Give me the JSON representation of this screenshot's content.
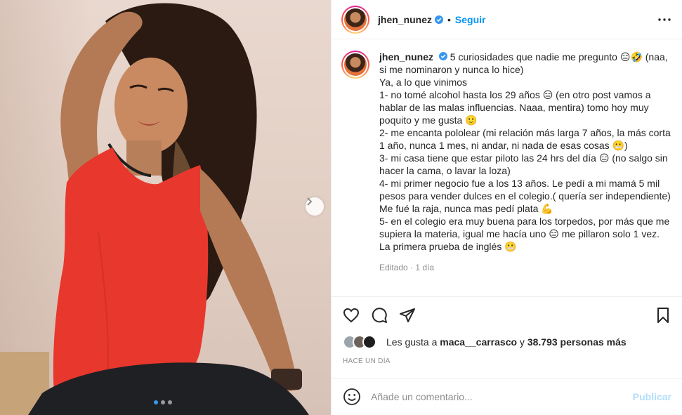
{
  "header": {
    "username": "jhen_nunez",
    "separator": "•",
    "follow_label": "Seguir",
    "more_icon": "more-horizontal-icon",
    "verified_icon": "verified-badge-icon"
  },
  "caption": {
    "username": "jhen_nunez",
    "lines": [
      "5 curiosidades que nadie me pregunto 😑🤣 (naa, si me nominaron y nunca lo hice)",
      "Ya, a lo que vinimos",
      "1- no tomé alcohol hasta los 29 años 😑 (en otro post vamos a hablar de las malas influencias. Naaa, mentira) tomo hoy muy poquito y me gusta 🙂",
      "2- me encanta pololear (mi relación más larga 7 años, la más corta 1 año, nunca 1 mes, ni andar, ni nada de esas cosas 😬)",
      "3- mi casa tiene que estar piloto las 24 hrs del día 😑 (no salgo sin hacer la cama, o lavar la loza)",
      "4- mi primer negocio fue a los 13 años. Le pedí a mi mamá 5 mil pesos para vender dulces en el colegio.( quería ser independiente) Me fué la raja, nunca mas pedí plata 💪",
      "5- en el colegio era muy buena para los torpedos, por más que me supiera la materia, igual me hacía uno 😑 me pillaron solo 1 vez. La primera prueba de inglés 😬"
    ],
    "meta": "Editado · 1 día"
  },
  "actions": {
    "like_icon": "heart-icon",
    "comment_icon": "comment-icon",
    "share_icon": "share-icon",
    "save_icon": "bookmark-icon"
  },
  "likes": {
    "prefix": "Les gusta a ",
    "first_user": "maca__carrasco",
    "middle": " y ",
    "count_text": "38.793 personas más"
  },
  "timestamp": "Hace un día",
  "comment": {
    "placeholder": "Añade un comentario...",
    "publish_label": "Publicar",
    "emoji_icon": "smiley-icon"
  },
  "carousel": {
    "slide_count": 3,
    "active_index": 0,
    "next_icon": "chevron-right-icon"
  },
  "colors": {
    "accent": "#0095f6",
    "publish_disabled": "#b2dffc",
    "text": "#262626",
    "muted": "#8e8e8e"
  }
}
